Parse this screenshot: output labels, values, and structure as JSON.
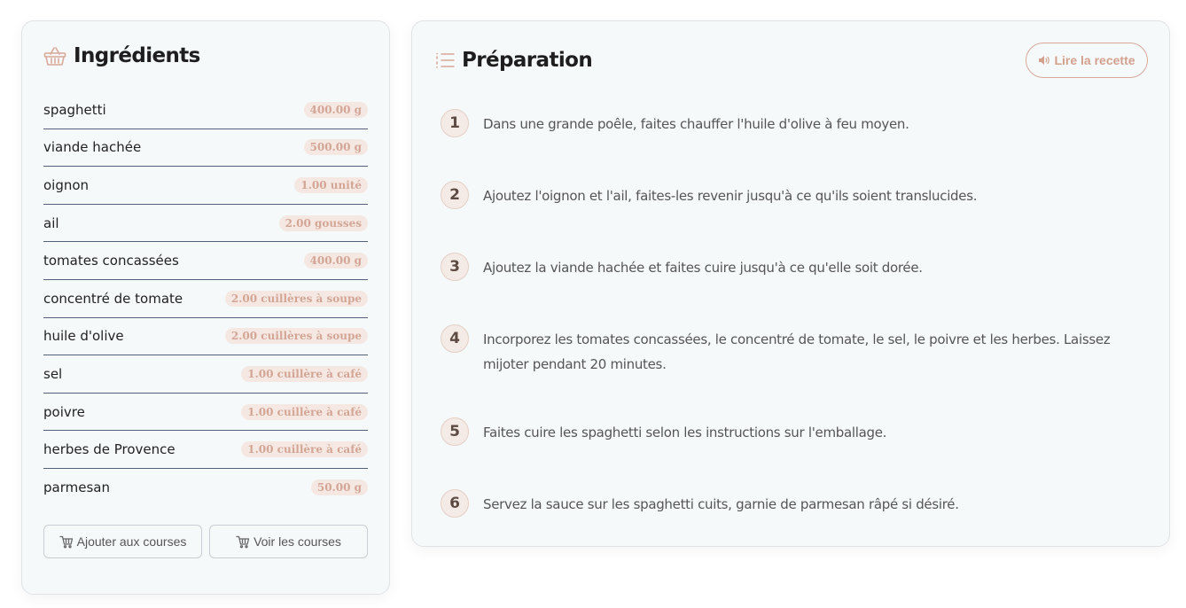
{
  "ingredients": {
    "title": "Ingrédients",
    "items": [
      {
        "name": "spaghetti",
        "qty": "400.00 g"
      },
      {
        "name": "viande hachée",
        "qty": "500.00 g"
      },
      {
        "name": "oignon",
        "qty": "1.00 unité"
      },
      {
        "name": "ail",
        "qty": "2.00 gousses"
      },
      {
        "name": "tomates concassées",
        "qty": "400.00 g"
      },
      {
        "name": "concentré de tomate",
        "qty": "2.00 cuillères à soupe"
      },
      {
        "name": "huile d'olive",
        "qty": "2.00 cuillères à soupe"
      },
      {
        "name": "sel",
        "qty": "1.00 cuillère à café"
      },
      {
        "name": "poivre",
        "qty": "1.00 cuillère à café"
      },
      {
        "name": "herbes de Provence",
        "qty": "1.00 cuillère à café"
      },
      {
        "name": "parmesan",
        "qty": "50.00 g"
      }
    ],
    "add_button": "Ajouter aux courses",
    "view_button": "Voir les courses"
  },
  "preparation": {
    "title": "Préparation",
    "read_button": "Lire la recette",
    "steps": [
      {
        "num": "1",
        "text": "Dans une grande poêle, faites chauffer l'huile d'olive à feu moyen."
      },
      {
        "num": "2",
        "text": "Ajoutez l'oignon et l'ail, faites-les revenir jusqu'à ce qu'ils soient translucides."
      },
      {
        "num": "3",
        "text": "Ajoutez la viande hachée et faites cuire jusqu'à ce qu'elle soit dorée."
      },
      {
        "num": "4",
        "text": "Incorporez les tomates concassées, le concentré de tomate, le sel, le poivre et les herbes. Laissez mijoter pendant 20 minutes."
      },
      {
        "num": "5",
        "text": "Faites cuire les spaghetti selon les instructions sur l'emballage."
      },
      {
        "num": "6",
        "text": "Servez la sauce sur les spaghetti cuits, garnie de parmesan râpé si désiré."
      }
    ]
  },
  "icons": {
    "title_icons": [
      "basket-icon",
      "list-icon"
    ],
    "button_icons": [
      "cart-icon",
      "speaker-icon"
    ]
  },
  "colors": {
    "accent": "#d3a08e",
    "badge_bg": "#f5e8e2",
    "card_bg": "#f6f9fa",
    "divider": "#53607a"
  }
}
